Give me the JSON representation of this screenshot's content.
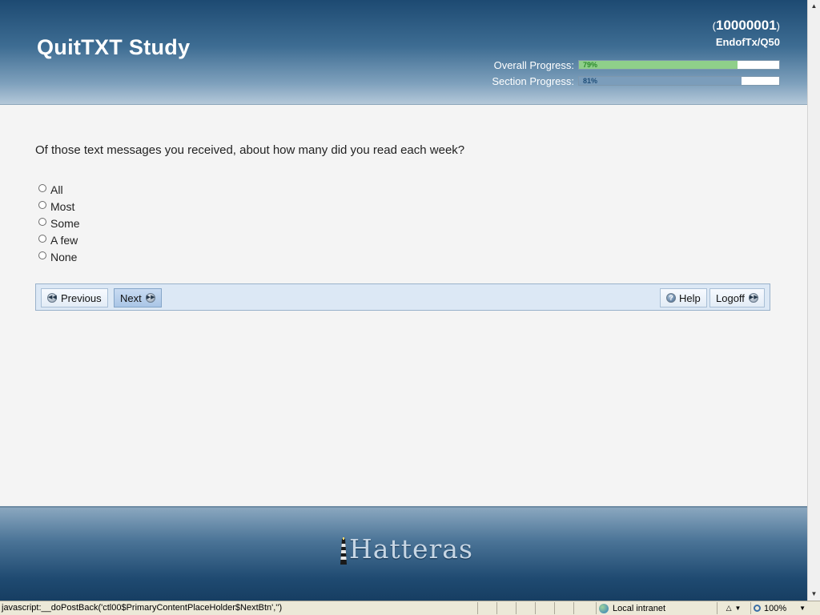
{
  "header": {
    "title": "QuitTXT Study",
    "participant_open": "(",
    "participant_id": "10000001",
    "participant_close": ")",
    "location": "EndofTx/Q50",
    "overall_label": "Overall Progress:",
    "overall_percent_text": "79%",
    "overall_value": 79,
    "section_label": "Section Progress:",
    "section_percent_text": "81%",
    "section_value": 81
  },
  "question": {
    "text": "Of those text messages you received, about how many did you read each week?",
    "options": [
      "All",
      "Most",
      "Some",
      "A few",
      "None"
    ]
  },
  "nav": {
    "previous_label": "Previous",
    "next_label": "Next",
    "help_label": "Help",
    "logoff_label": "Logoff"
  },
  "footer": {
    "logo_text": "Hatteras"
  },
  "statusbar": {
    "url_text": "javascript:__doPostBack('ctl00$PrimaryContentPlaceHolder$NextBtn','')",
    "zone_text": "Local intranet",
    "zoom_text": "100%"
  },
  "icons": {
    "previous": "rewind-circle-icon",
    "next": "fast-forward-circle-icon",
    "help": "question-circle-icon",
    "logoff": "fast-forward-circle-icon",
    "zone": "globe-icon",
    "zoom": "magnifier-icon"
  },
  "colors": {
    "header_dark": "#1d4a72",
    "overall_fill": "#8fcf8a",
    "section_fill": "#7b9dbb",
    "navbar_bg": "#dce8f5"
  }
}
